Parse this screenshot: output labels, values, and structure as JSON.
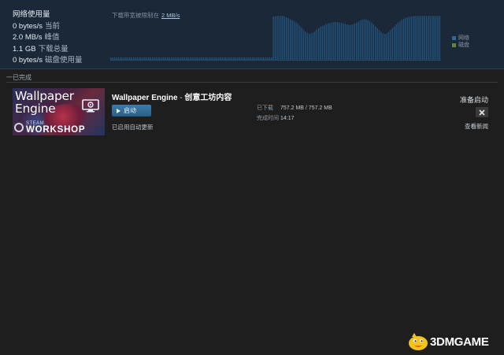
{
  "network": {
    "title": "网络使用量",
    "stats": [
      {
        "value": "0 bytes/s",
        "label": "当前"
      },
      {
        "value": "2.0 MB/s",
        "label": "峰值"
      },
      {
        "value": "1.1 GB",
        "label": "下载总量"
      },
      {
        "value": "0 bytes/s",
        "label": "磁盘使用量"
      }
    ],
    "limit_label": "下载带宽被限制在",
    "limit_value": "2 MB/s",
    "graph_values": [
      0.05,
      0.05,
      0.05,
      0.05,
      0.05,
      0.05,
      0.05,
      0.05,
      0.05,
      0.05,
      0.05,
      0.05,
      0.05,
      0.05,
      0.05,
      0.05,
      0.05,
      0.05,
      0.05,
      0.05,
      0.05,
      0.05,
      0.05,
      0.05,
      0.05,
      0.05,
      0.05,
      0.05,
      0.05,
      0.05,
      0.05,
      0.05,
      0.05,
      0.05,
      0.05,
      0.05,
      0.05,
      0.05,
      0.05,
      0.05,
      0.05,
      0.05,
      0.05,
      0.05,
      0.05,
      0.05,
      0.05,
      0.05,
      0.05,
      0.05,
      0.05,
      0.05,
      0.05,
      0.05,
      0.05,
      0.05,
      0.05,
      0.05,
      0.05,
      0.05,
      0.05,
      0.05,
      0.05,
      0.05,
      0.05,
      0.05,
      0.05,
      0.05,
      0.05,
      0.05,
      0.05,
      0.05,
      0.05,
      0.05,
      0.05,
      0.05,
      0.05,
      0.05,
      0.05,
      0.05,
      0.05,
      0.05,
      0.05,
      0.05,
      0.05,
      0.05,
      0.92,
      0.92,
      0.93,
      0.93,
      0.93,
      0.93,
      0.92,
      0.9,
      0.88,
      0.86,
      0.84,
      0.82,
      0.79,
      0.76,
      0.72,
      0.68,
      0.64,
      0.6,
      0.57,
      0.55,
      0.56,
      0.58,
      0.61,
      0.64,
      0.67,
      0.7,
      0.72,
      0.74,
      0.76,
      0.77,
      0.78,
      0.79,
      0.8,
      0.8,
      0.8,
      0.79,
      0.78,
      0.77,
      0.76,
      0.75,
      0.74,
      0.74,
      0.75,
      0.77,
      0.79,
      0.81,
      0.83,
      0.85,
      0.86,
      0.86,
      0.84,
      0.82,
      0.79,
      0.75,
      0.71,
      0.67,
      0.63,
      0.59,
      0.56,
      0.55,
      0.56,
      0.59,
      0.63,
      0.67,
      0.71,
      0.75,
      0.79,
      0.82,
      0.85,
      0.87,
      0.89,
      0.9,
      0.91,
      0.92,
      0.92,
      0.93,
      0.93,
      0.93,
      0.93,
      0.93,
      0.93,
      0.93,
      0.93,
      0.93,
      0.93,
      0.93,
      0.93,
      0.93,
      0.93
    ],
    "legend": [
      {
        "label": "网络",
        "color": "#2f6a96"
      },
      {
        "label": "磁盘",
        "color": "#5a8a3a"
      }
    ],
    "network_color": "#22517a"
  },
  "section": {
    "header": "一已完成"
  },
  "download": {
    "thumb_title_line1": "Wallpaper",
    "thumb_title_line2": "Engine",
    "steam_label": "STEAM",
    "workshop_label": "WORKSHOP",
    "game_name": "Wallpaper Engine",
    "separator": " - ",
    "content_name": "创意工坊内容",
    "launch_label": "启动",
    "auto_update": "已启用自动更新",
    "downloaded_label": "已下载",
    "downloaded_value": "757.2 MB / 757.2 MB",
    "finished_label": "完成时间",
    "finished_value": "14:17",
    "status": "准备启动",
    "news_link": "查看新闻"
  },
  "watermark": {
    "text": "3DMGAME"
  },
  "icons": {
    "close": "close-icon",
    "play": "play-icon",
    "monitor": "monitor-gear-icon",
    "steam": "steam-icon"
  }
}
